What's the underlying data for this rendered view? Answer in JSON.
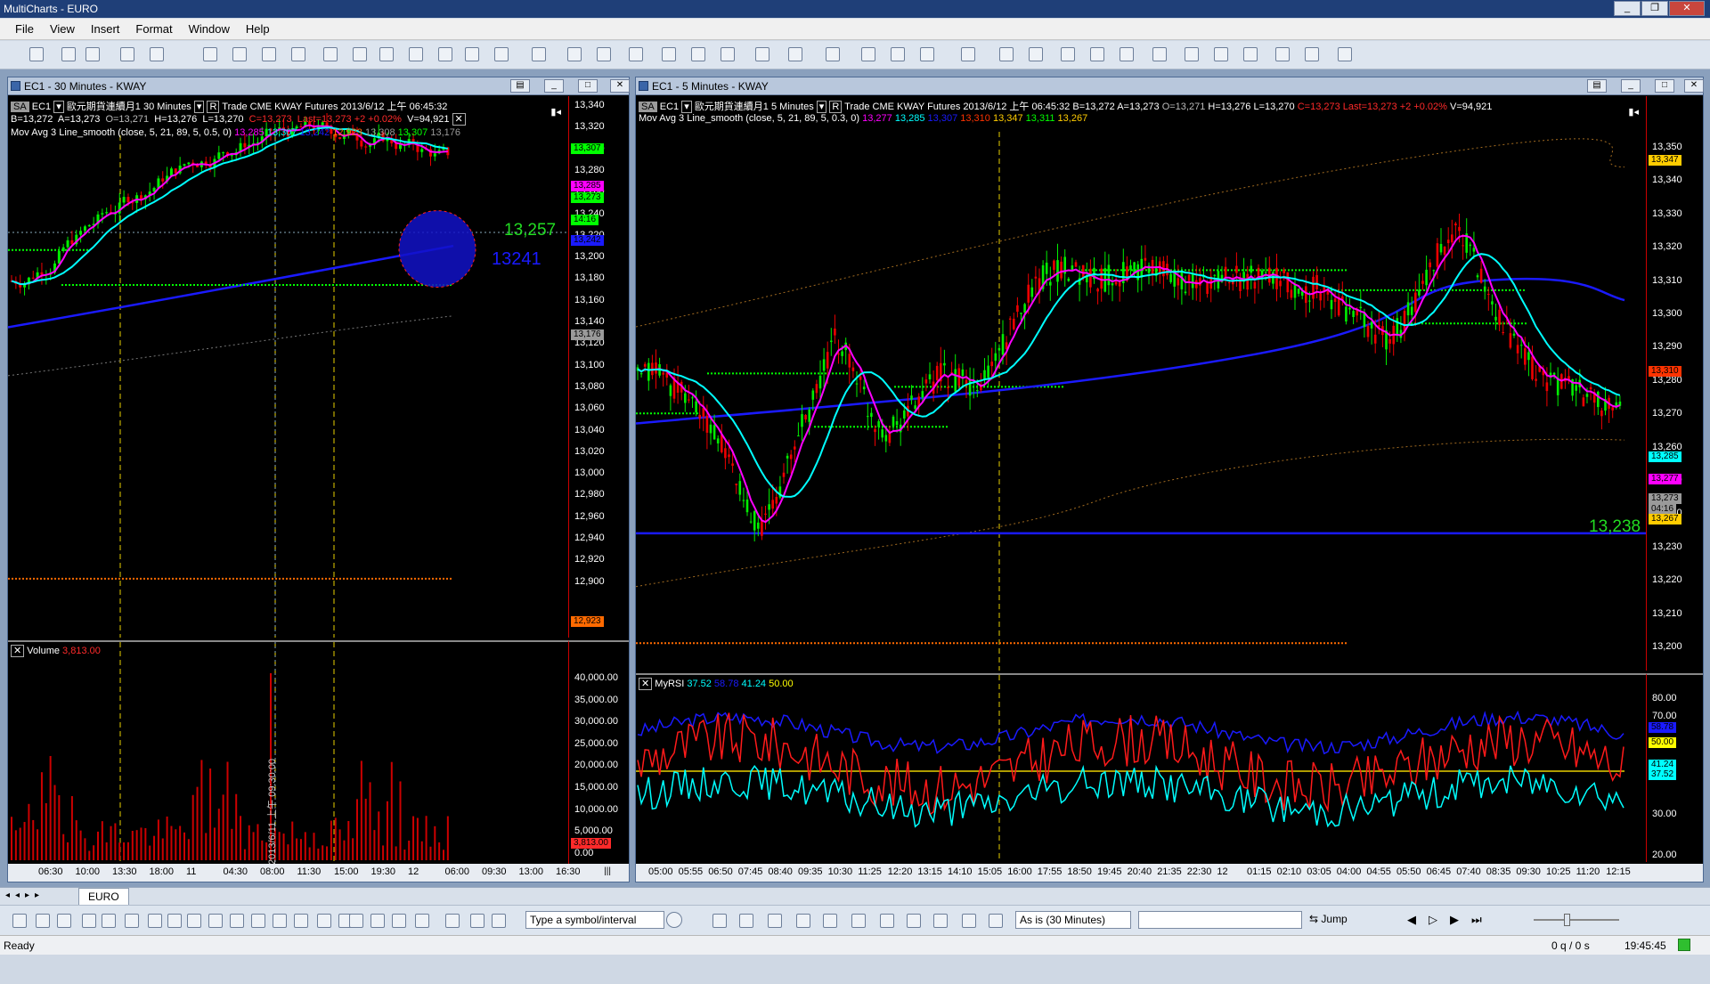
{
  "app": {
    "title": "MultiCharts - EURO"
  },
  "menu": [
    "File",
    "View",
    "Insert",
    "Format",
    "Window",
    "Help"
  ],
  "left_chart": {
    "title": "EC1 - 30 Minutes - KWAY",
    "header": {
      "symbol_tag": "SA",
      "symbol": "EC1",
      "description": "歐元期貨連續月1",
      "interval": "30 Minutes",
      "r": "R",
      "data": "Trade  CME  KWAY  Futures  2013/6/12  上午 06:45:32",
      "b": "B=13,272",
      "a": "A=13,273",
      "o": "O=13,271",
      "h": "H=13,276",
      "l": "L=13,270",
      "c": "C=13,273",
      "last": "Last=13,273  +2  +0.02%",
      "v": "V=94,921"
    },
    "indicator": {
      "name": "Mov Avg 3 Line_smooth",
      "params": "(close,  5,  21,  89,  5,  0.5,  0)",
      "values": [
        {
          "v": "13,285",
          "color": "#ff00ff"
        },
        {
          "v": "13,307",
          "color": "#00ffff"
        },
        {
          "v": "13,242",
          "color": "#1a1aff"
        },
        {
          "v": "12,923",
          "color": "#ff6a00"
        },
        {
          "v": "13,308",
          "color": "#9a9a9a"
        },
        {
          "v": "13,307",
          "color": "#00ff00"
        },
        {
          "v": "13,176",
          "color": "#9a9a9a"
        }
      ]
    },
    "annotations": {
      "price": "13,257",
      "circle_label": "13241"
    },
    "y_ticks": [
      "13,340",
      "13,320",
      "13,300",
      "13,280",
      "13,260",
      "13,240",
      "13,220",
      "13,200",
      "13,180",
      "13,160",
      "13,140",
      "13,120",
      "13,100",
      "13,080",
      "13,060",
      "13,040",
      "13,020",
      "13,000",
      "12,980",
      "12,960",
      "12,940",
      "12,920",
      "12,900"
    ],
    "y_tags": [
      {
        "v": "13,307",
        "color": "#00ff00"
      },
      {
        "v": "13,285",
        "color": "#ff00ff"
      },
      {
        "v": "13,273",
        "color": "#00ff00"
      },
      {
        "v": "14:16",
        "color": "#00ff00"
      },
      {
        "v": "13,242",
        "color": "#1a1aff"
      },
      {
        "v": "13,176",
        "color": "#9a9a9a"
      },
      {
        "v": "12,923",
        "color": "#ff6a00"
      }
    ],
    "volume": {
      "name": "Volume",
      "value": "3,813.00",
      "y_ticks": [
        "40,000.00",
        "35,000.00",
        "30,000.00",
        "25,000.00",
        "20,000.00",
        "15,000.00",
        "10,000.00",
        "5,000.00",
        "0.00"
      ],
      "tag": "3,813.00",
      "cursor_label": "2013/6/11 上午 09:30:00"
    },
    "x_ticks": [
      "06:30",
      "10:00",
      "13:30",
      "18:00",
      "11",
      "04:30",
      "08:00",
      "11:30",
      "15:00",
      "19:30",
      "12",
      "06:00",
      "09:30",
      "13:00",
      "16:30"
    ]
  },
  "right_chart": {
    "title": "EC1 - 5 Minutes - KWAY",
    "header": {
      "symbol_tag": "SA",
      "symbol": "EC1",
      "description": "歐元期貨連續月1",
      "interval": "5 Minutes",
      "r": "R",
      "data": "Trade  CME  KWAY  Futures  2013/6/12  上午 06:45:32",
      "b": "B=13,272",
      "a": "A=13,273",
      "o": "O=13,271",
      "h": "H=13,276",
      "l": "L=13,270",
      "c": "C=13,273",
      "last": "Last=13,273  +2  +0.02%",
      "v": "V=94,921"
    },
    "indicator": {
      "name": "Mov Avg 3 Line_smooth",
      "params": "(close,  5,  21,  89,  5,  0.3,  0)",
      "values": [
        {
          "v": "13,277",
          "color": "#ff00ff"
        },
        {
          "v": "13,285",
          "color": "#00ffff"
        },
        {
          "v": "13,307",
          "color": "#1a1aff"
        },
        {
          "v": "13,310",
          "color": "#ff3300"
        },
        {
          "v": "13,347",
          "color": "#ffcc00"
        },
        {
          "v": "13,311",
          "color": "#00ff00"
        },
        {
          "v": "13,267",
          "color": "#ffcc00"
        }
      ]
    },
    "annotations": {
      "price": "13,238"
    },
    "y_ticks": [
      "13,350",
      "13,340",
      "13,330",
      "13,320",
      "13,310",
      "13,300",
      "13,290",
      "13,280",
      "13,270",
      "13,260",
      "13,250",
      "13,240",
      "13,230",
      "13,220",
      "13,210",
      "13,200"
    ],
    "y_tags": [
      {
        "v": "13,347",
        "color": "#ffcc00"
      },
      {
        "v": "13,310",
        "color": "#ff3300"
      },
      {
        "v": "13,285",
        "color": "#00ffff"
      },
      {
        "v": "13,277",
        "color": "#ff00ff"
      },
      {
        "v": "13,273",
        "color": "#9a9a9a"
      },
      {
        "v": "04:16",
        "color": "#9a9a9a"
      },
      {
        "v": "13,267",
        "color": "#ffcc00"
      }
    ],
    "rsi": {
      "name": "MyRSI",
      "values": [
        {
          "v": "37.52",
          "color": "#00ffff"
        },
        {
          "v": "58.78",
          "color": "#1a1aff"
        },
        {
          "v": "41.24",
          "color": "#00ffff"
        },
        {
          "v": "50.00",
          "color": "#ffff00"
        }
      ],
      "y_ticks": [
        "80.00",
        "70.00",
        "30.00",
        "20.00"
      ],
      "y_tags": [
        {
          "v": "58.78",
          "color": "#1a1aff"
        },
        {
          "v": "50.00",
          "color": "#ffff00"
        },
        {
          "v": "41.24",
          "color": "#00ffff"
        },
        {
          "v": "37.52",
          "color": "#00ffff"
        }
      ]
    },
    "x_ticks": [
      "05:00",
      "05:55",
      "06:50",
      "07:45",
      "08:40",
      "09:35",
      "10:30",
      "11:25",
      "12:20",
      "13:15",
      "14:10",
      "15:05",
      "16:00",
      "17:55",
      "18:50",
      "19:45",
      "20:40",
      "21:35",
      "22:30",
      "12",
      "01:15",
      "02:10",
      "03:05",
      "04:00",
      "04:55",
      "05:50",
      "06:45",
      "07:40",
      "08:35",
      "09:30",
      "10:25",
      "11:20",
      "12:15"
    ]
  },
  "workspace_tab": "EURO",
  "toolbar2": {
    "symbol_placeholder": "Type a symbol/interval",
    "resolution": "As is (30 Minutes)",
    "jump": "Jump"
  },
  "status": {
    "text": "Ready",
    "queue": "0 q / 0 s",
    "time": "19:45:45"
  }
}
